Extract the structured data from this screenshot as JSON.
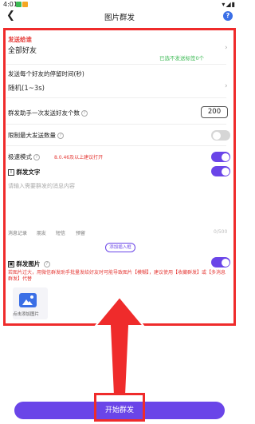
{
  "status": {
    "time": "4:01",
    "right": "▾◢▮"
  },
  "header": {
    "title": "图片群发"
  },
  "send_to": {
    "label": "发送给谁",
    "value": "全部好友",
    "selected_tag": "已选不发送标签0个"
  },
  "interval": {
    "label": "发送每个好友的停留时间(秒)",
    "value": "随机(1~3s)"
  },
  "per_batch": {
    "label": "群发助手一次发送好友个数",
    "value": "200"
  },
  "limit": {
    "label": "限制最大发送数量"
  },
  "fast_mode": {
    "label": "极速模式",
    "note": "8.0.46及以上建议打开"
  },
  "text": {
    "label": "群发文字",
    "placeholder": "请输入需要群发的消息内容",
    "tools": [
      "消息记录",
      "朋友",
      "短信",
      "预留"
    ],
    "count": "0/500",
    "add_var": "添加插入框"
  },
  "image": {
    "label": "群发图片",
    "warning": "若图片过大，用微信群发助手批量发给好友时可能导致图片【模糊】，建议使用【收藏群发】或【多消息群发】代替",
    "add_label": "点击添加图片"
  },
  "start_button": "开始群发",
  "colors": {
    "accent": "#6a45e8",
    "highlight": "#ef2b2b",
    "tag_green": "#3cba54",
    "warning_red": "#e53935"
  },
  "icons": [
    "back-icon",
    "help-icon",
    "chevron-right-icon",
    "question-icon",
    "text-icon",
    "image-icon",
    "add-image-icon"
  ]
}
